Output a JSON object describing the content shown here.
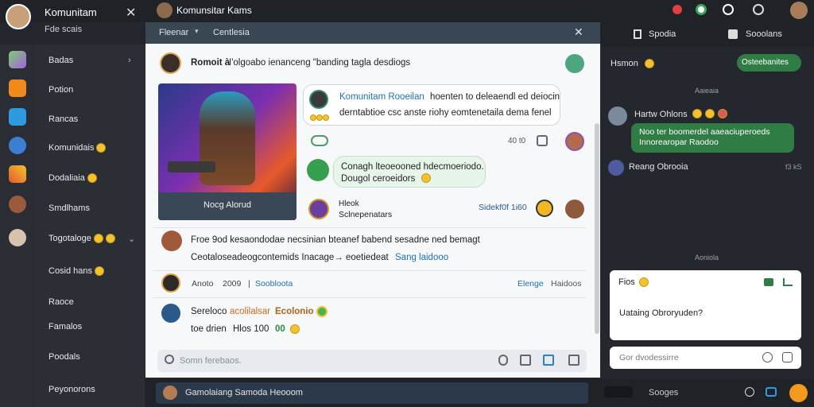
{
  "header": {
    "app_title": "Komunitam",
    "app_subtitle": "Fde scais",
    "chat_title": "Komunsitar Kams"
  },
  "nav": {
    "items": [
      {
        "label": "Badas",
        "chevron": true
      },
      {
        "label": "Potion"
      },
      {
        "label": "Rancas"
      },
      {
        "label": "Komunidais",
        "emoji": true
      },
      {
        "label": "Dodaliaia",
        "emoji": true
      },
      {
        "label": "Smdlhams"
      },
      {
        "label": "Togotaloge",
        "emoji": true,
        "chevron": true
      },
      {
        "label": "Cosid hans",
        "emoji": true
      },
      {
        "label": "Raoce"
      },
      {
        "label": "Famalos"
      },
      {
        "label": "Poodals"
      },
      {
        "label": "Peyonorons"
      }
    ]
  },
  "center": {
    "tabs": [
      "Fleenar",
      "Centlesia"
    ],
    "post_title": "Romoit à",
    "post_subtitle": "I'olgoabo ienanceng \"banding tagla desdiogs",
    "image_caption": "Nocg Alorud",
    "bubble1_name": "Komunitam Rooeilan",
    "bubble1_text1": "hoenten to deleaendl ed deiocin",
    "bubble1_text2": "derntabtioe csc anste riohy eomtenetaila dema fenel",
    "meta1": "40 t0",
    "bubble2_text1": "Conagh lteoeooned hdecmoeriodo.",
    "bubble2_text2": "Dougol ceroeidors",
    "row_name1": "Hleok",
    "row_name2": "Sclnepenatars",
    "row_time": "Sidekf0f 1i60",
    "post2_title": "Froe 9od kesaondodae necsinian bteanef babend sesadne ned bemagt",
    "post2_text": "Ceotaloseadeogcontemids Inacage→ eoetiedeat",
    "post2_link": "Sang laidooo",
    "row3_date": "Anoto",
    "row3_year": "2009",
    "row3_link": "Soobloota",
    "row3_right1": "Elenge",
    "row3_right2": "Haidoos",
    "post3_title": "Sereloco",
    "post3_link": "acolilalsar",
    "post3_name": "Ecolonio",
    "post3_meta": "toe drien",
    "post3_meta2": "Hlos 100",
    "post3_badge": "00",
    "search_placeholder": "Somn ferebaos."
  },
  "right": {
    "tab1": "Spodia",
    "tab2": "Sooolans",
    "room_name": "Hsmon",
    "room_button": "Osteebanites",
    "divider1": "Aaieaia",
    "user1": "Hartw Ohlons",
    "user1_msg": "Noo ter boomerdel aaeaciuperoeds Innorearopar Raodoo",
    "user2": "Reang Obrooia",
    "user2_time": "f3 kS",
    "divider2": "Aoniola",
    "card_title": "Fios",
    "card_text": "Uataing Obroryuden?",
    "reply_placeholder": "Gor dvodessirre",
    "bottom_label": "Sooges"
  },
  "bottom": {
    "status": "Gamolaiang Samoda Heooom"
  },
  "colors": {
    "accent_green": "#2f7d45",
    "link_blue": "#1e6fb8",
    "header_blue": "#394654",
    "send_orange": "#f39a1c"
  }
}
